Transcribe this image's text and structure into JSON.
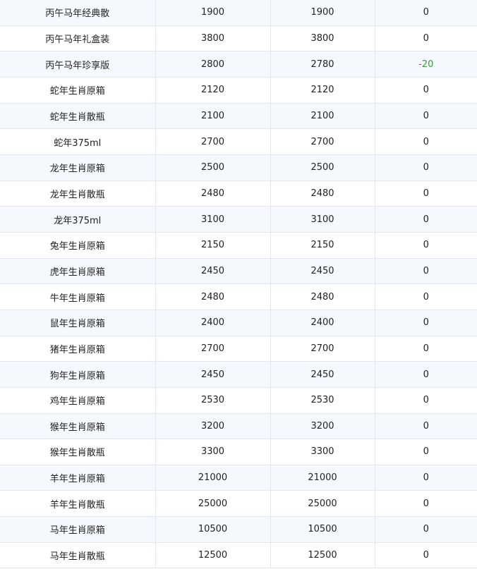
{
  "table": {
    "rows": [
      {
        "name": "丙午马年经典散",
        "price1": "1900",
        "price2": "1900",
        "change": "0"
      },
      {
        "name": "丙午马年礼盒装",
        "price1": "3800",
        "price2": "3800",
        "change": "0"
      },
      {
        "name": "丙午马年珍享版",
        "price1": "2800",
        "price2": "2780",
        "change": "-20"
      },
      {
        "name": "蛇年生肖原箱",
        "price1": "2120",
        "price2": "2120",
        "change": "0"
      },
      {
        "name": "蛇年生肖散瓶",
        "price1": "2100",
        "price2": "2100",
        "change": "0"
      },
      {
        "name": "蛇年375ml",
        "price1": "2700",
        "price2": "2700",
        "change": "0"
      },
      {
        "name": "龙年生肖原箱",
        "price1": "2500",
        "price2": "2500",
        "change": "0"
      },
      {
        "name": "龙年生肖散瓶",
        "price1": "2480",
        "price2": "2480",
        "change": "0"
      },
      {
        "name": "龙年375ml",
        "price1": "3100",
        "price2": "3100",
        "change": "0"
      },
      {
        "name": "兔年生肖原箱",
        "price1": "2150",
        "price2": "2150",
        "change": "0"
      },
      {
        "name": "虎年生肖原箱",
        "price1": "2450",
        "price2": "2450",
        "change": "0"
      },
      {
        "name": "牛年生肖原箱",
        "price1": "2480",
        "price2": "2480",
        "change": "0"
      },
      {
        "name": "鼠年生肖原箱",
        "price1": "2400",
        "price2": "2400",
        "change": "0"
      },
      {
        "name": "猪年生肖原箱",
        "price1": "2700",
        "price2": "2700",
        "change": "0"
      },
      {
        "name": "狗年生肖原箱",
        "price1": "2450",
        "price2": "2450",
        "change": "0"
      },
      {
        "name": "鸡年生肖原箱",
        "price1": "2530",
        "price2": "2530",
        "change": "0"
      },
      {
        "name": "猴年生肖原箱",
        "price1": "3200",
        "price2": "3200",
        "change": "0"
      },
      {
        "name": "猴年生肖散瓶",
        "price1": "3300",
        "price2": "3300",
        "change": "0"
      },
      {
        "name": "羊年生肖原箱",
        "price1": "21000",
        "price2": "21000",
        "change": "0"
      },
      {
        "name": "羊年生肖散瓶",
        "price1": "25000",
        "price2": "25000",
        "change": "0"
      },
      {
        "name": "马年生肖原箱",
        "price1": "10500",
        "price2": "10500",
        "change": "0"
      },
      {
        "name": "马年生肖散瓶",
        "price1": "12500",
        "price2": "12500",
        "change": "0"
      }
    ]
  },
  "colors": {
    "stripe": "#f5f8fd",
    "border": "#e3e6ec",
    "decrease": "#3c9a3c"
  }
}
